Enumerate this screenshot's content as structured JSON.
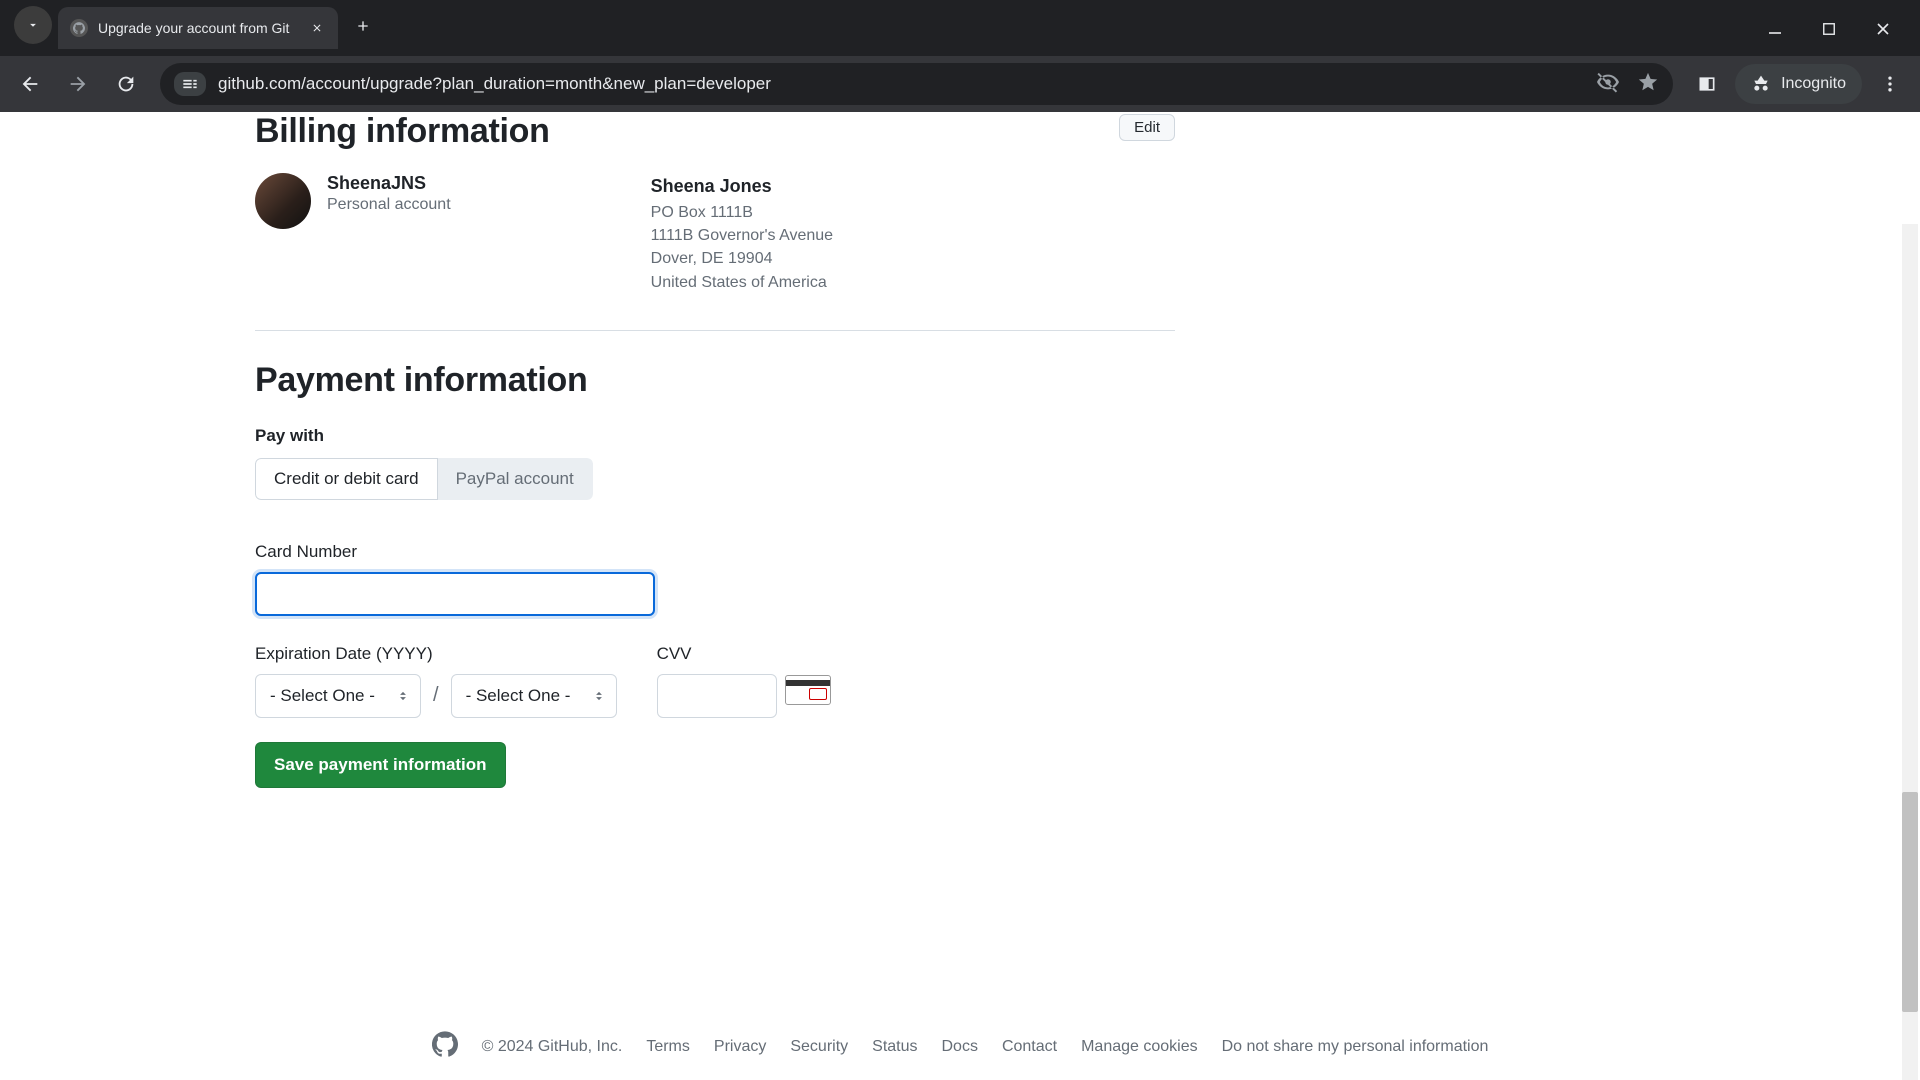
{
  "browser": {
    "tab_title": "Upgrade your account from Git",
    "url": "github.com/account/upgrade?plan_duration=month&new_plan=developer",
    "incognito_label": "Incognito"
  },
  "billing": {
    "heading": "Billing information",
    "edit_label": "Edit",
    "username": "SheenaJNS",
    "account_type": "Personal account",
    "full_name": "Sheena Jones",
    "address_line1": "PO Box 1111B",
    "address_line2": "1111B Governor's Avenue",
    "address_line3": "Dover, DE 19904",
    "address_line4": "United States of America"
  },
  "payment": {
    "heading": "Payment information",
    "pay_with_label": "Pay with",
    "method_card": "Credit or debit card",
    "method_paypal": "PayPal account",
    "card_number_label": "Card Number",
    "card_number_value": "",
    "expiration_label": "Expiration Date (YYYY)",
    "exp_month_placeholder": "- Select One -",
    "exp_year_placeholder": "- Select One -",
    "cvv_label": "CVV",
    "cvv_value": "",
    "save_button": "Save payment information"
  },
  "footer": {
    "copyright": "© 2024 GitHub, Inc.",
    "links": [
      "Terms",
      "Privacy",
      "Security",
      "Status",
      "Docs",
      "Contact",
      "Manage cookies",
      "Do not share my personal information"
    ]
  }
}
